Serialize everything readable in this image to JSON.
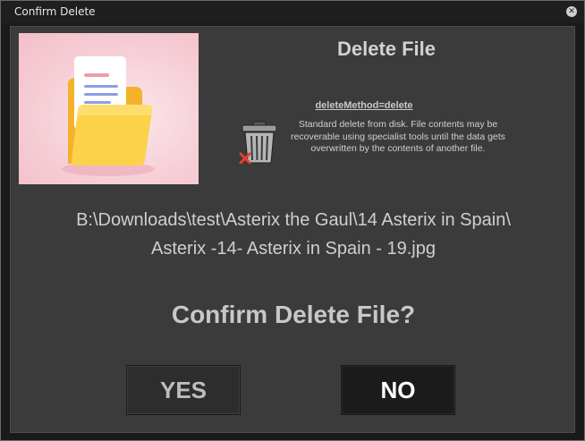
{
  "window": {
    "title": "Confirm Delete",
    "close_icon": "close-icon"
  },
  "dialog": {
    "heading": "Delete File",
    "method_label": "deleteMethod=delete",
    "method_description": "Standard delete from disk. File contents may be recoverable using specialist tools until the data gets overwritten by the contents of another file.",
    "method_icon": "trash-can-delete-icon",
    "thumbnail_icon": "folder-document-icon",
    "file_path_line1": "B:\\Downloads\\test\\Asterix the Gaul\\14 Asterix in Spain\\",
    "file_path_line2": "Asterix -14- Asterix in Spain - 19.jpg",
    "confirm_question": "Confirm Delete File?",
    "yes_label": "YES",
    "no_label": "NO"
  },
  "colors": {
    "window_bg": "#1a1a1a",
    "panel_bg": "#3b3b3b",
    "text": "#cfcfcf",
    "no_button_bg": "#1b1b1b",
    "yes_button_bg": "#2d2d2d"
  }
}
